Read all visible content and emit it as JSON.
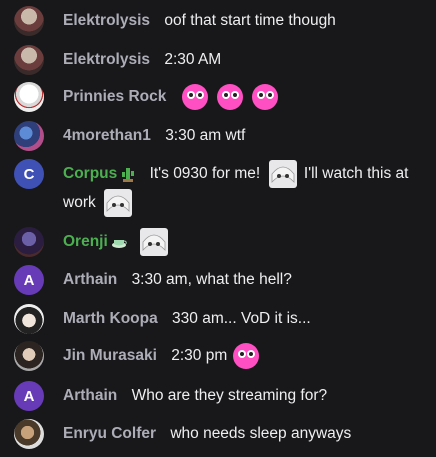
{
  "messages": [
    {
      "user": "Elektrolysis",
      "text": "oof that start time though"
    },
    {
      "user": "Elektrolysis",
      "text": "2:30 AM"
    },
    {
      "user": "Prinnies Rock",
      "text": ""
    },
    {
      "user": "4morethan1",
      "text": "3:30 am wtf"
    },
    {
      "user": "Corpus",
      "text_a": "It's 0930 for me!",
      "text_b": "I'll watch this at",
      "text_c": "work",
      "avatar_letter": "C"
    },
    {
      "user": "Orenji",
      "text": ""
    },
    {
      "user": "Arthain",
      "text": "3:30 am, what the hell?",
      "avatar_letter": "A"
    },
    {
      "user": "Marth Koopa",
      "text": "330 am... VoD it is..."
    },
    {
      "user": "Jin Murasaki",
      "text": "2:30 pm"
    },
    {
      "user": "Arthain",
      "text": "Who are they streaming for?",
      "avatar_letter": "A"
    },
    {
      "user": "Enryu Colfer",
      "text": "who needs sleep anyways"
    }
  ],
  "colors": {
    "background": "#18181b",
    "username": "#adadb8",
    "username_green": "#4caf50",
    "avatar_corpus": "#3f51b5",
    "avatar_arthain": "#673ab7",
    "emote_pink": "#ff4fc3"
  },
  "icons": [
    "pink-blob-emote",
    "white-hair-anime-emote",
    "cactus-badge",
    "tea-cup-badge"
  ]
}
